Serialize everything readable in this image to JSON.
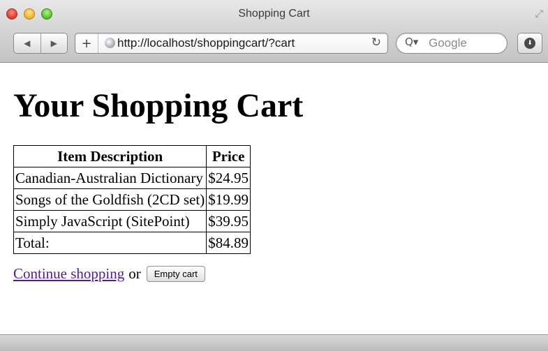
{
  "window": {
    "title": "Shopping Cart"
  },
  "toolbar": {
    "back_icon": "◀",
    "forward_icon": "▶",
    "new_tab_icon": "+",
    "url": "http://localhost/shoppingcart/?cart",
    "reload_icon": "↻",
    "search_icon": "Q▾",
    "search_placeholder": "Google",
    "download_icon": "⬇"
  },
  "page": {
    "heading": "Your Shopping Cart",
    "table": {
      "headers": [
        "Item Description",
        "Price"
      ],
      "rows": [
        {
          "description": "Canadian-Australian Dictionary",
          "price": "$24.95"
        },
        {
          "description": "Songs of the Goldfish (2CD set)",
          "price": "$19.99"
        },
        {
          "description": "Simply JavaScript (SitePoint)",
          "price": "$39.95"
        }
      ],
      "total_label": "Total:",
      "total_value": "$84.89"
    },
    "continue_link": "Continue shopping",
    "or_text": "or",
    "empty_button": "Empty cart"
  },
  "colors": {
    "visited_link": "#551a8b"
  }
}
